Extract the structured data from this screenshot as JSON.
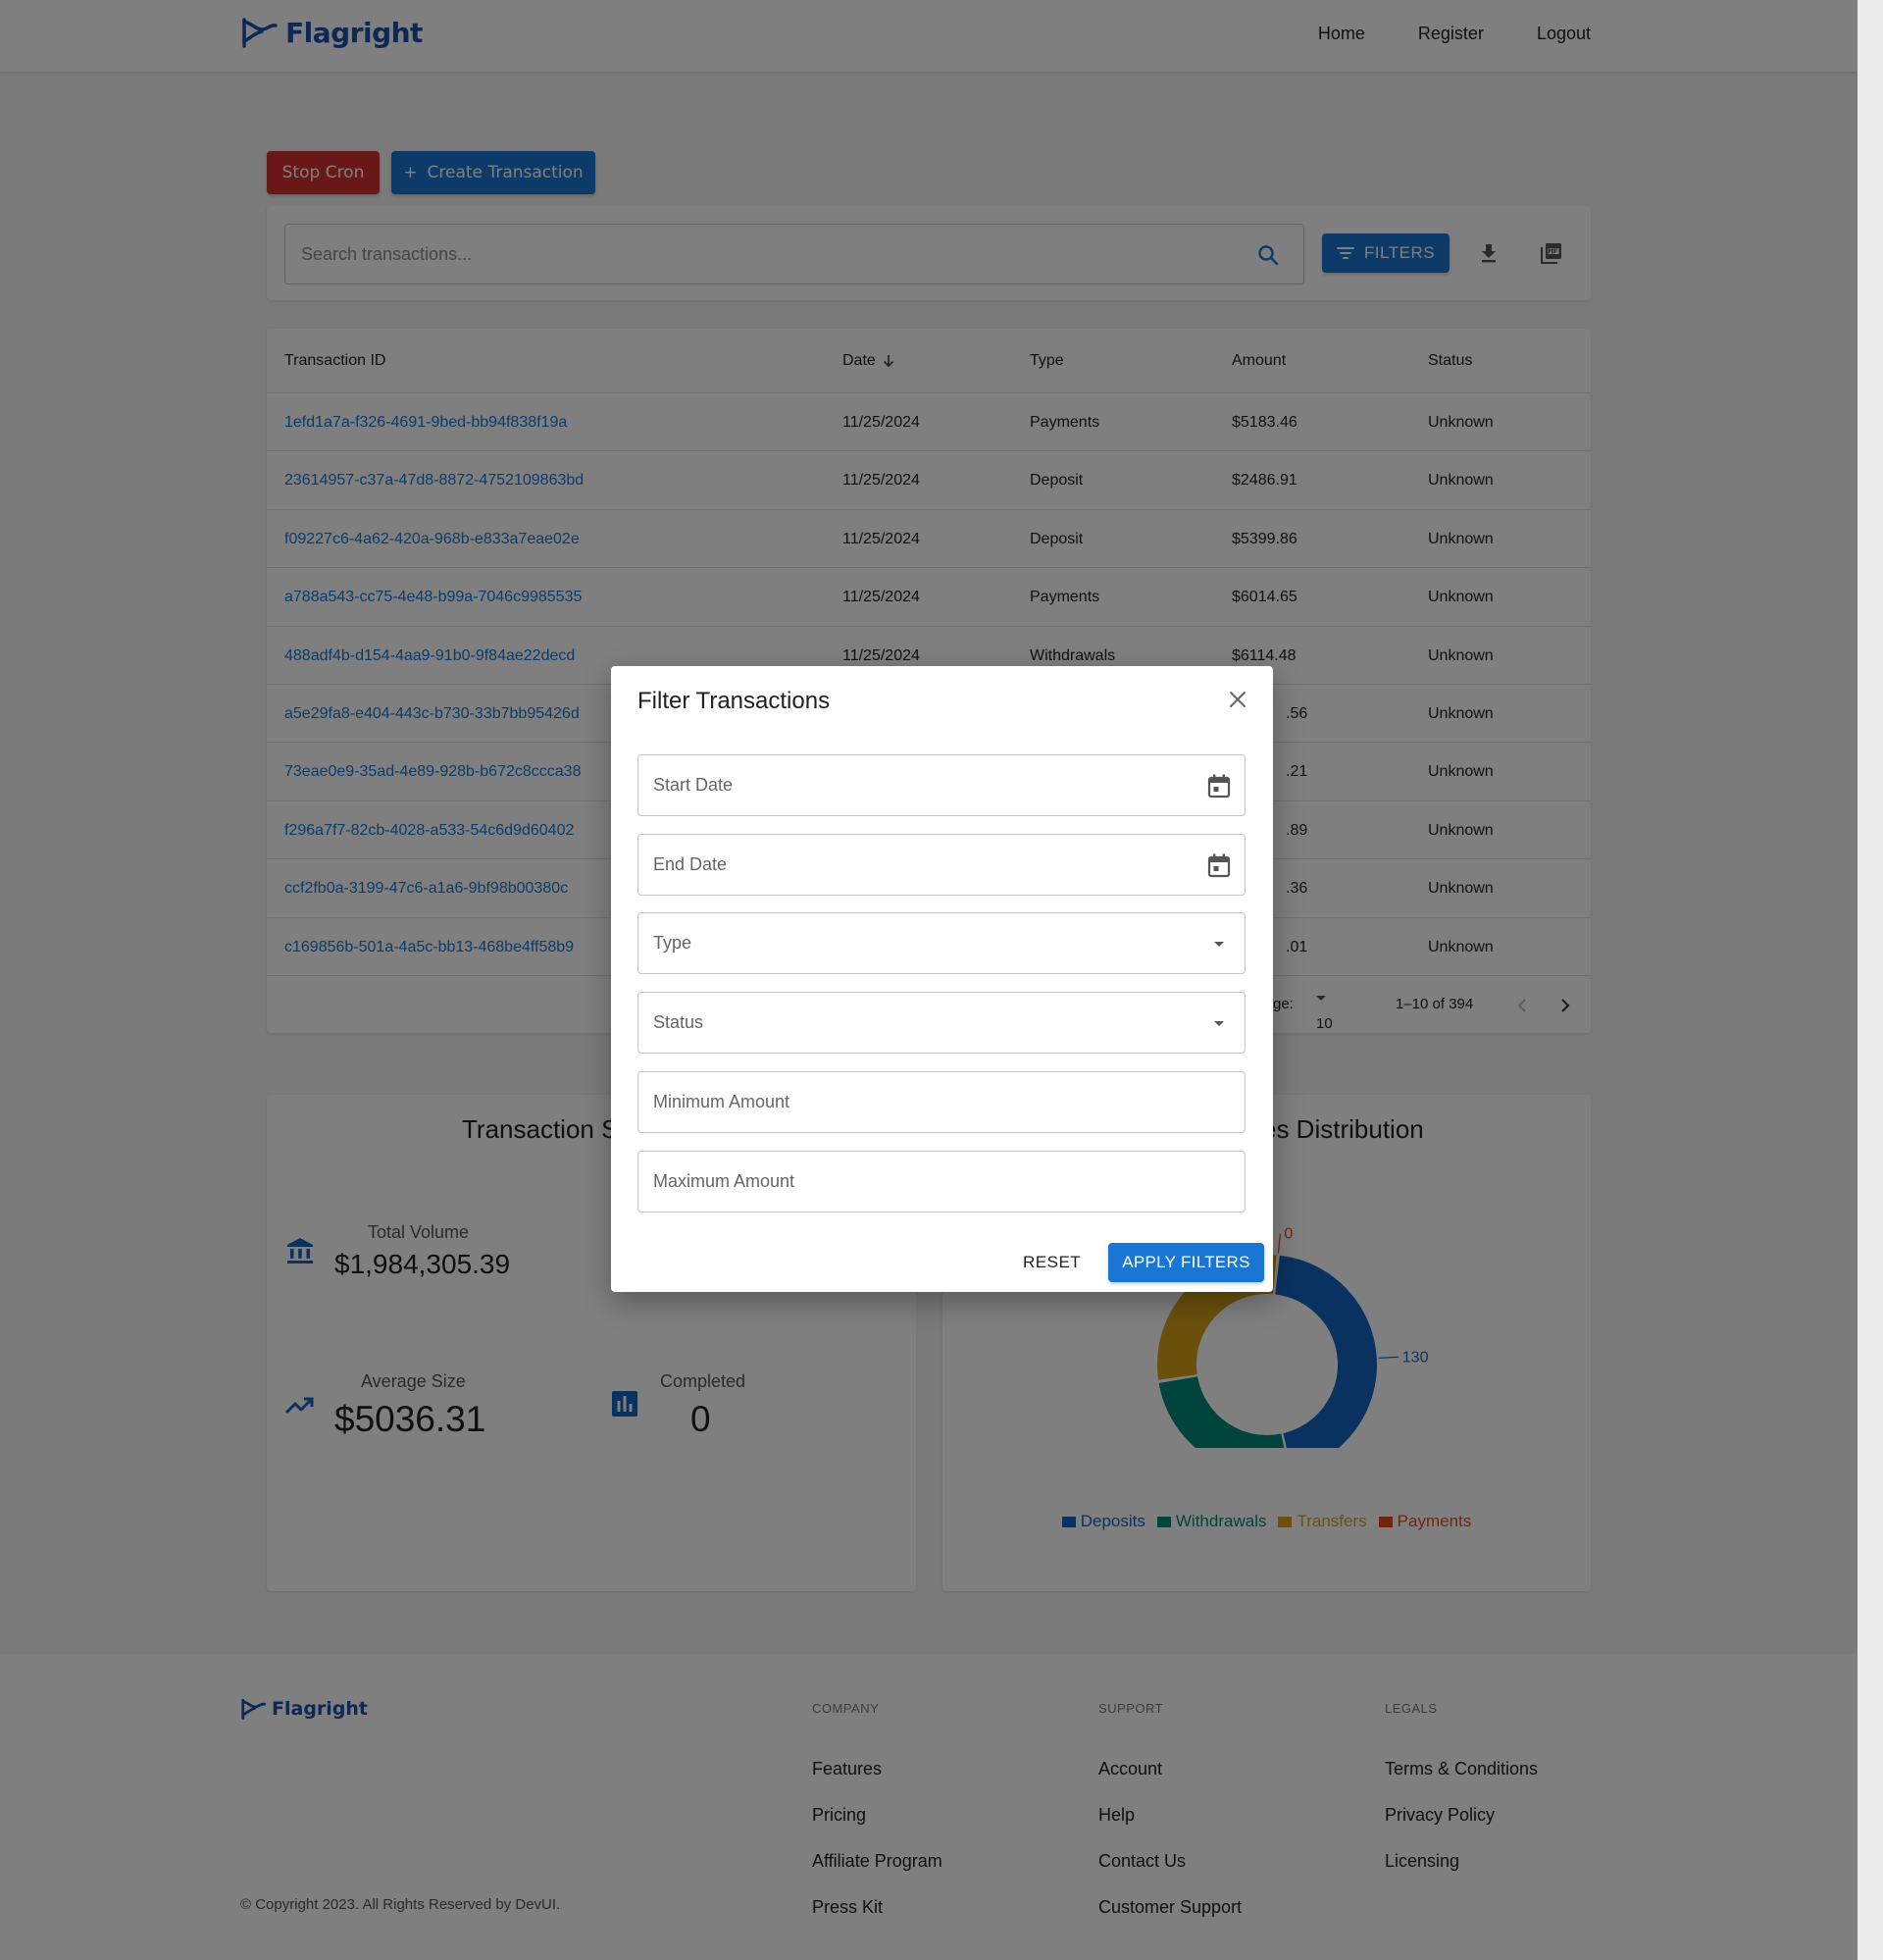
{
  "header": {
    "logo_text": "Flagright",
    "nav": [
      "Home",
      "Register",
      "Logout"
    ]
  },
  "actions": {
    "stop_cron_label": "Stop Cron",
    "create_label": "Create Transaction",
    "create_icon": "+"
  },
  "search": {
    "placeholder": "Search transactions...",
    "filters_label": "FILTERS"
  },
  "table": {
    "columns": [
      "Transaction ID",
      "Date",
      "Type",
      "Amount",
      "Status"
    ],
    "rows": [
      [
        "1efd1a7a-f326-4691-9bed-bb94f838f19a",
        "11/25/2024",
        "Payments",
        "$5183.46",
        "Unknown"
      ],
      [
        "23614957-c37a-47d8-8872-4752109863bd",
        "11/25/2024",
        "Deposit",
        "$2486.91",
        "Unknown"
      ],
      [
        "f09227c6-4a62-420a-968b-e833a7eae02e",
        "11/25/2024",
        "Deposit",
        "$5399.86",
        "Unknown"
      ],
      [
        "a788a543-cc75-4e48-b99a-7046c9985535",
        "11/25/2024",
        "Payments",
        "$6014.65",
        "Unknown"
      ],
      [
        "488adf4b-d154-4aa9-91b0-9f84ae22decd",
        "11/25/2024",
        "Withdrawals",
        "$6114.48",
        "Unknown"
      ],
      [
        "a5e29fa8-e404-443c-b730-33b7bb95426d",
        "",
        "",
        ".56",
        "Unknown"
      ],
      [
        "73eae0e9-35ad-4e89-928b-b672c8ccca38",
        "",
        "",
        ".21",
        "Unknown"
      ],
      [
        "f296a7f7-82cb-4028-a533-54c6d9d60402",
        "",
        "",
        ".89",
        "Unknown"
      ],
      [
        "ccf2fb0a-3199-47c6-a1a6-9bf98b00380c",
        "",
        "",
        ".36",
        "Unknown"
      ],
      [
        "c169856b-501a-4a5c-bb13-468be4ff58b9",
        "",
        "",
        ".01",
        "Unknown"
      ]
    ],
    "pager": {
      "rows_per_page_label": "ge:",
      "rows_per_page_value": "10",
      "range": "1–10 of 394"
    }
  },
  "summary": {
    "title_visible": "Transaction S",
    "total_volume_label": "Total Volume",
    "total_volume_value": "$1,984,305.39",
    "average_size_label": "Average Size",
    "average_size_value": "$5036.31",
    "completed_label": "Completed",
    "completed_value": "0"
  },
  "distribution": {
    "title_visible": "es Distribution",
    "chart_data": {
      "type": "pie",
      "categories": [
        "Deposits",
        "Withdrawals",
        "Transfers",
        "Payments"
      ],
      "values": [
        130,
        75,
        84,
        0
      ],
      "colors": [
        "#1565c0",
        "#00897b",
        "#d4a017",
        "#e64a19"
      ]
    }
  },
  "modal": {
    "title": "Filter Transactions",
    "fields": {
      "start_date": "Start Date",
      "end_date": "End Date",
      "type": "Type",
      "status": "Status",
      "min_amount": "Minimum Amount",
      "max_amount": "Maximum Amount"
    },
    "reset_label": "RESET",
    "apply_label": "APPLY FILTERS"
  },
  "footer": {
    "logo_text": "Flagright",
    "company_head": "COMPANY",
    "company_links": [
      "Features",
      "Pricing",
      "Affiliate Program",
      "Press Kit"
    ],
    "support_head": "SUPPORT",
    "support_links": [
      "Account",
      "Help",
      "Contact Us",
      "Customer Support"
    ],
    "legals_head": "LEGALS",
    "legals_links": [
      "Terms & Conditions",
      "Privacy Policy",
      "Licensing"
    ],
    "copyright": "© Copyright 2023. All Rights Reserved by DevUI."
  },
  "colors": {
    "primary": "#1976d2",
    "danger": "#d32f2f",
    "brand": "#1f4fa8"
  }
}
